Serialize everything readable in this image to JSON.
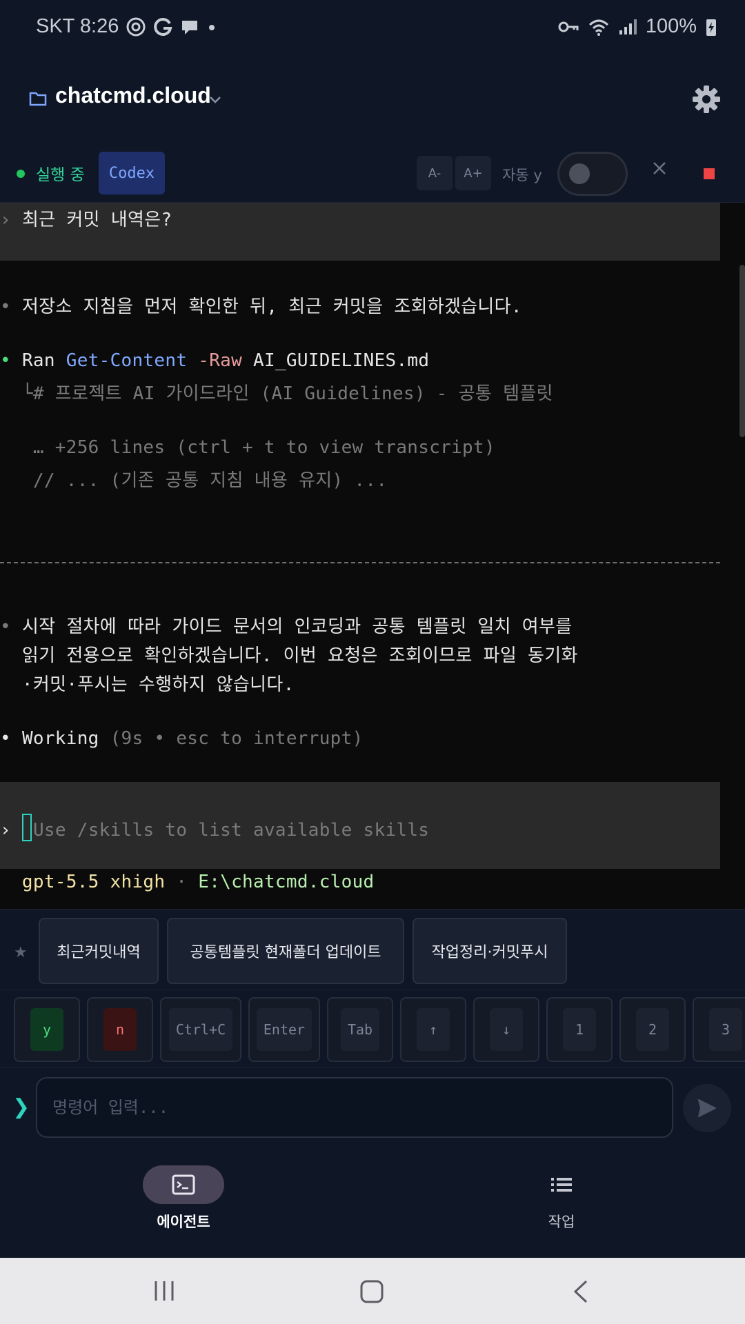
{
  "status_bar": {
    "carrier_time": "SKT 8:26",
    "battery": "100%"
  },
  "header": {
    "project": "chatcmd.cloud"
  },
  "controls": {
    "status": "실행 중",
    "agent": "Codex",
    "font_smaller": "A-",
    "font_larger": "A+",
    "auto_label": "자동 y",
    "auto_enabled": false
  },
  "terminal": {
    "prompt_marker": "›",
    "bullet": "•",
    "user_query": "최근 커밋 내역은?",
    "msg1": "저장소 지침을 먼저 확인한 뒤, 최근 커밋을 조회하겠습니다.",
    "ran_word": "Ran",
    "ran_cmd": "Get-Content",
    "ran_flag": "-Raw",
    "ran_arg": "AI_GUIDELINES.md",
    "tree_marker": "└",
    "out_line1": "# 프로젝트 AI 가이드라인 (AI Guidelines) - 공통 템플릿",
    "out_line2": "… +256 lines (ctrl + t to view transcript)",
    "out_line3": "// ... (기존 공통 지침 내용 유지) ...",
    "msg2_line1": "시작 절차에 따라 가이드 문서의 인코딩과 공통 템플릿 일치 여부를",
    "msg2_line2": "읽기 전용으로 확인하겠습니다. 이번 요청은 조회이므로 파일 동기화",
    "msg2_line3": "·커밋·푸시는 수행하지 않습니다.",
    "working_word": "Working",
    "working_hint": "(9s • esc to interrupt)",
    "input_placeholder": "Use /skills to list available skills",
    "model": "gpt-5.5 xhigh",
    "sep": "·",
    "path": "E:\\chatcmd.cloud"
  },
  "chips": [
    "최근커밋내역",
    "공통템플릿 현재폴더 업데이트",
    "작업정리·커밋푸시"
  ],
  "keys": [
    "y",
    "n",
    "Ctrl+C",
    "Enter",
    "Tab",
    "↑",
    "↓",
    "1",
    "2",
    "3"
  ],
  "input": {
    "placeholder": "명령어 입력..."
  },
  "nav": {
    "agent": "에이전트",
    "tasks": "작업"
  },
  "colors": {
    "accent_teal": "#2dd4bf",
    "running_green": "#34d399",
    "stop_red": "#ef4444",
    "codex_blue": "#7fa6ff"
  }
}
